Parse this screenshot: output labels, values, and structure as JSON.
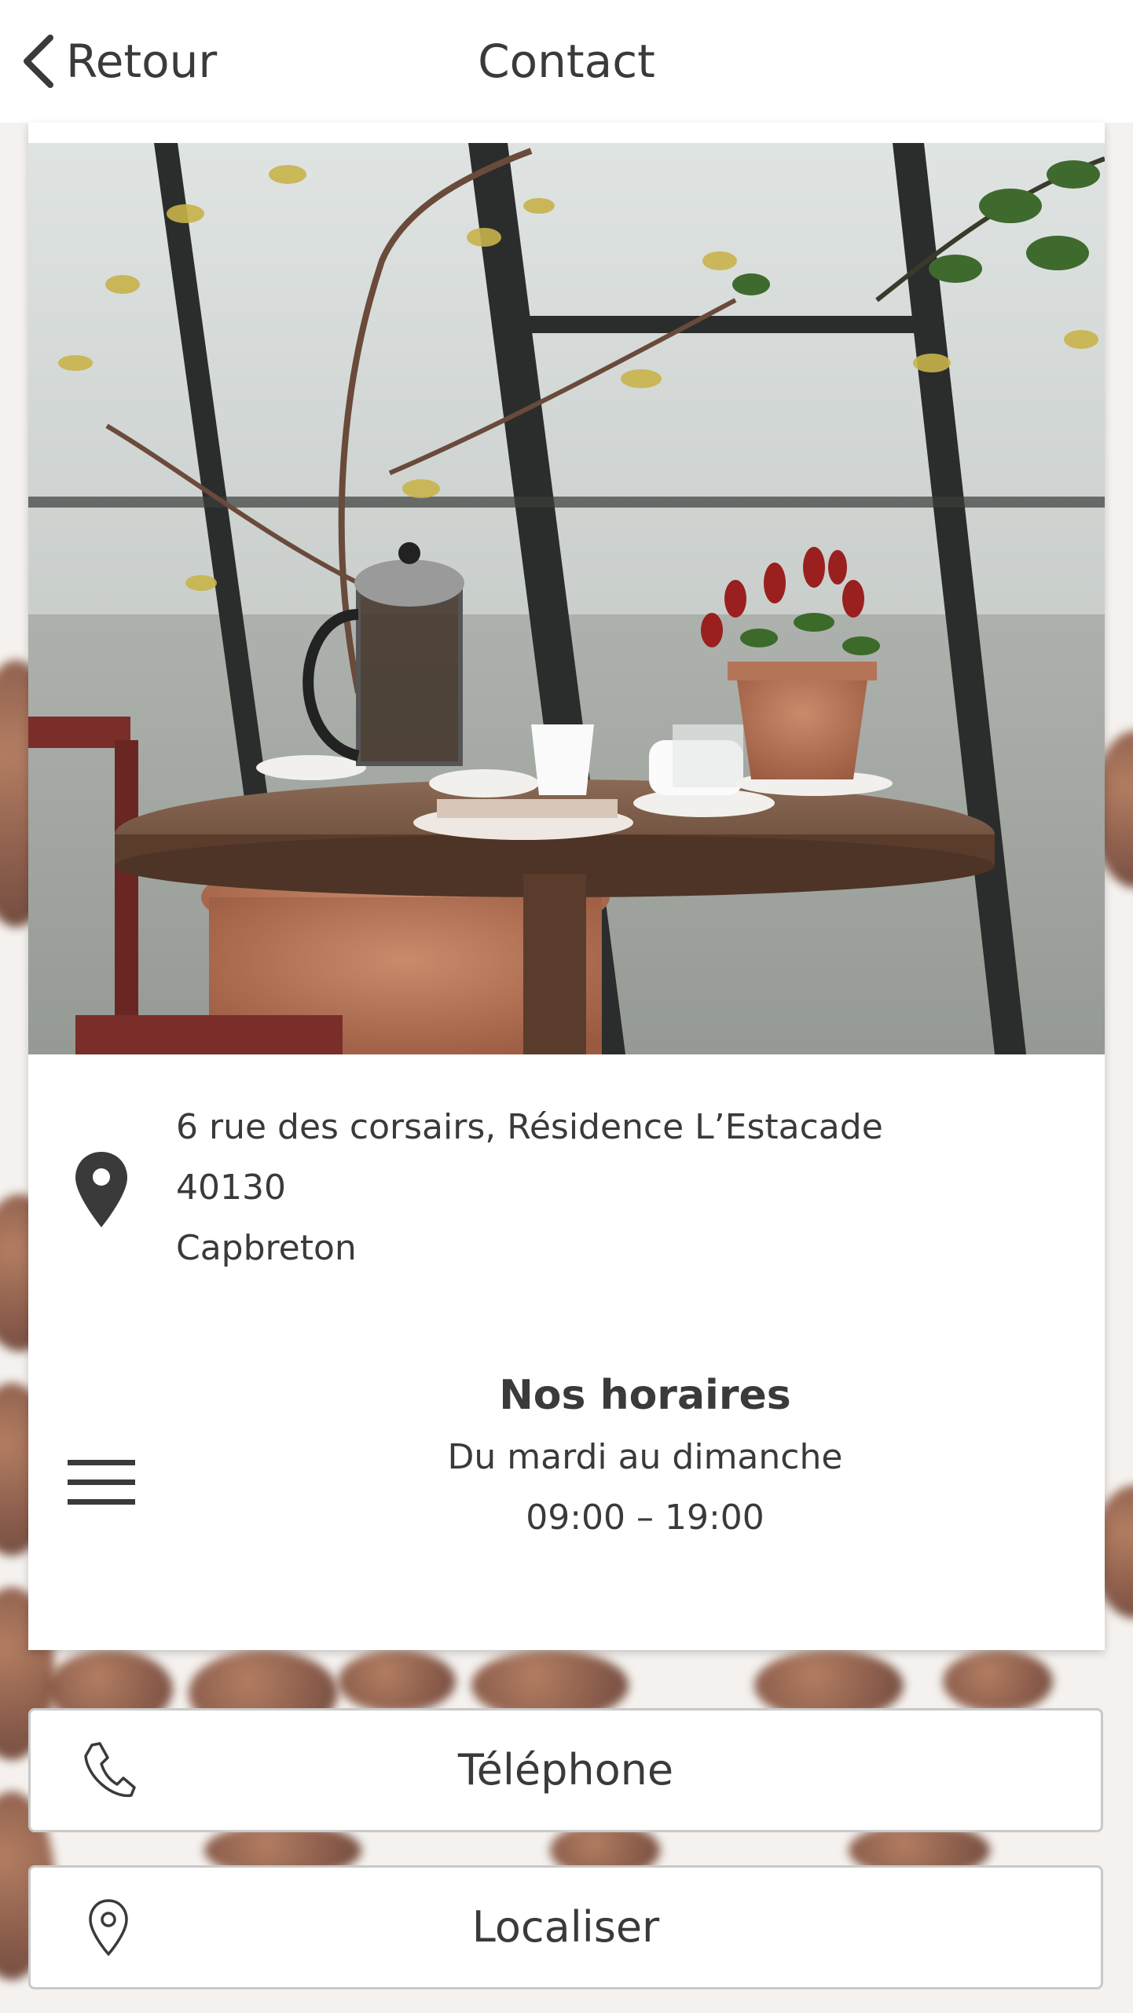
{
  "header": {
    "back_label": "Retour",
    "title": "Contact"
  },
  "address": {
    "line1": "6 rue des corsairs, Résidence L’Estacade",
    "line2": "40130",
    "line3": "Capbreton"
  },
  "hours": {
    "title": "Nos horaires",
    "days": "Du mardi au dimanche",
    "times": "09:00 – 19:00"
  },
  "actions": {
    "phone_label": "Téléphone",
    "locate_label": "Localiser"
  },
  "icons": {
    "back": "chevron-left-icon",
    "address": "map-pin-icon",
    "hours": "menu-lines-icon",
    "phone": "phone-icon",
    "locate": "location-pin-icon"
  },
  "colors": {
    "text": "#3a3a3a",
    "card": "#ffffff",
    "button_border": "#c9c9c9"
  }
}
